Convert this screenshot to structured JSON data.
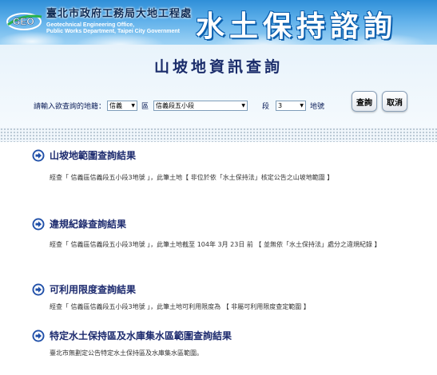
{
  "banner": {
    "org_name_cn": "臺北市政府工務局大地工程處",
    "org_name_en_1": "Geotechnical Engineering Office,",
    "org_name_en_2": "Public Works Department, Taipei City Government",
    "title": "水土保持諮詢",
    "logo_text": "GEO"
  },
  "query": {
    "page_title": "山坡地資訊查詢",
    "prompt_label": "請輸入欲查詢的地籍：",
    "district_value": "信義",
    "district_label": "區",
    "section_value": "信義段五小段",
    "section_label": "段",
    "lot_value": "3",
    "lot_label": "地號",
    "search_button": "查詢",
    "cancel_button": "取消"
  },
  "results": [
    {
      "title": "山坡地範圍查詢結果",
      "body": "經查「 信義區信義段五小段3地號 」，此筆土地【 非位於依「水土保持法」核定公告之山坡地範圍 】"
    },
    {
      "title": "違規紀錄查詢結果",
      "body": "經查「 信義區信義段五小段3地號 」，此筆土地截至 104年 3月 23日 前 【 並無依「水土保持法」處分之違規紀錄 】"
    },
    {
      "title": "可利用限度查詢結果",
      "body": "經查「 信義區信義段五小段3地號 」，此筆土地可利用限度為 【 非屬可利用限度查定範圍 】"
    },
    {
      "title": "特定水土保持區及水庫集水區範圍查詢結果",
      "body": "臺北市無劃定公告特定水土保持區及水庫集水區範圍。"
    }
  ],
  "colors": {
    "title_navy": "#1b2d6b",
    "arrow_blue": "#1f4fa8",
    "banner_blue": "#2f8fd8"
  },
  "icons": {
    "section_bullet": "circle-arrow-right-icon",
    "select_arrow": "triangle-down-icon"
  }
}
